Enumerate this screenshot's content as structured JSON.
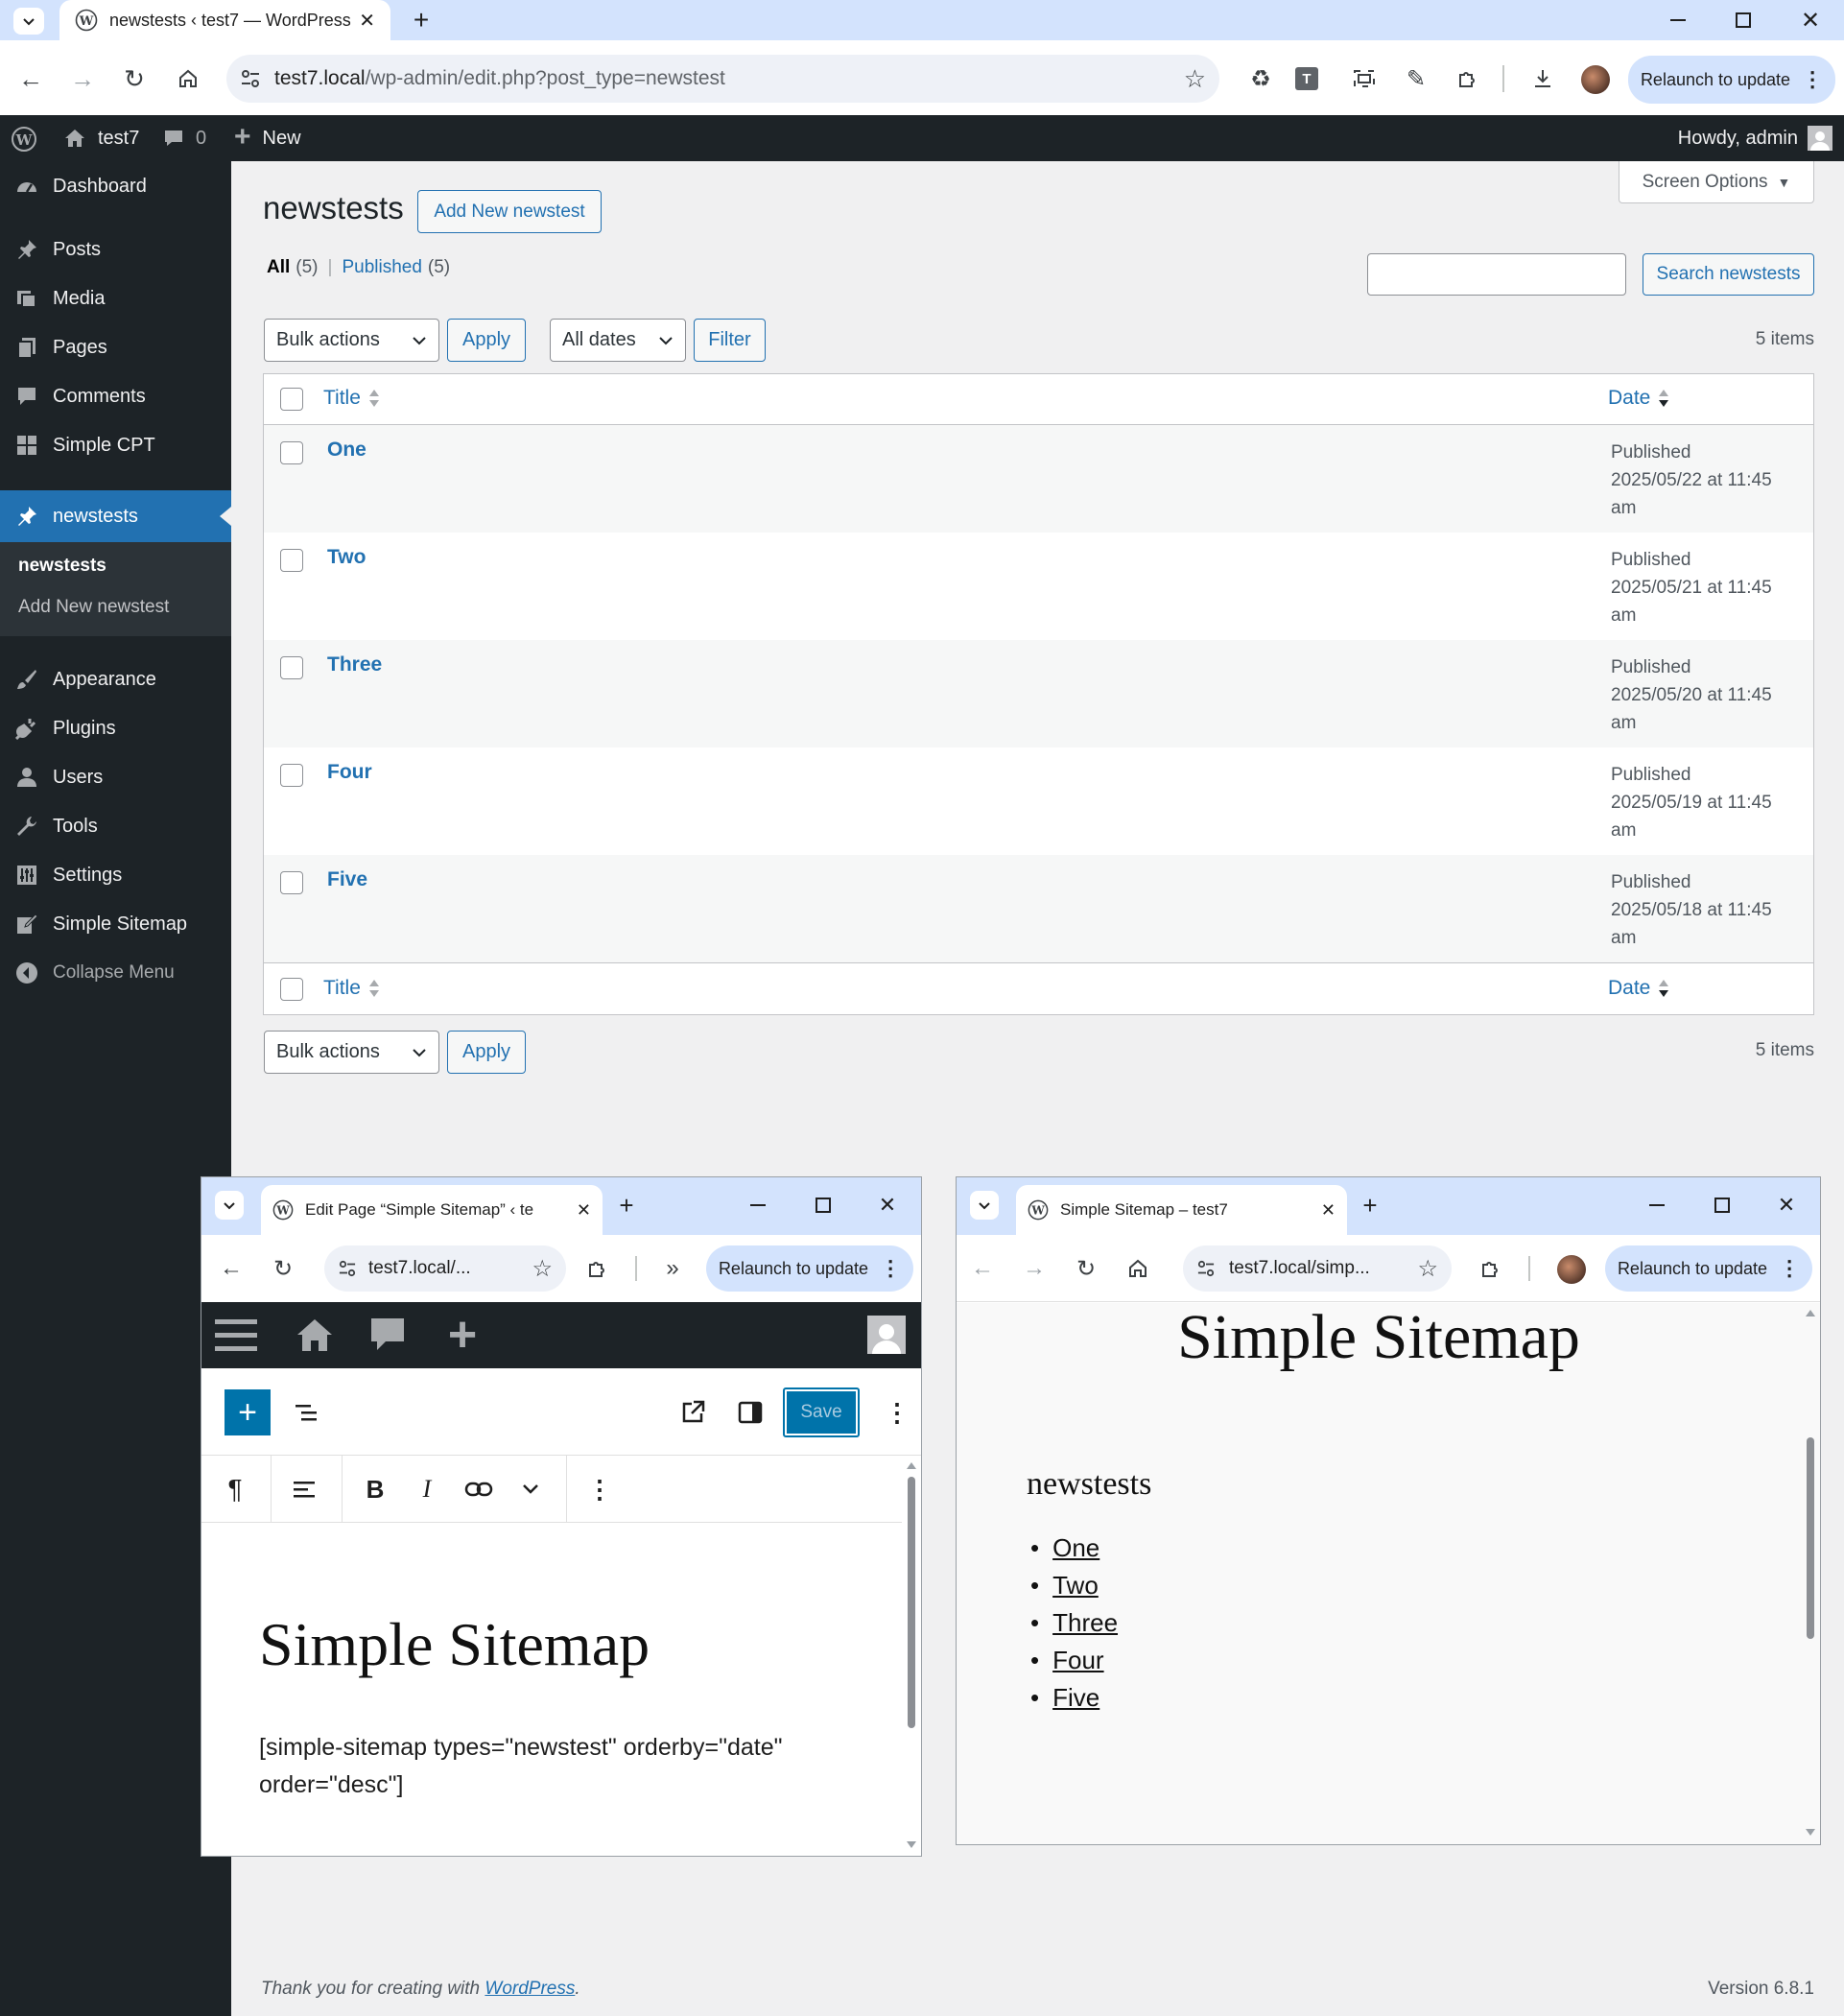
{
  "browser": {
    "tab_title": "newstests ‹ test7 — WordPress",
    "url_host": "test7.local",
    "url_path": "/wp-admin/edit.php?post_type=newstest",
    "relaunch": "Relaunch to update"
  },
  "adminbar": {
    "site": "test7",
    "comments": "0",
    "new": "New",
    "howdy": "Howdy, admin"
  },
  "sidebar": {
    "items": [
      {
        "label": "Dashboard",
        "icon": "dashboard-icon"
      },
      {
        "label": "Posts",
        "icon": "pin-icon"
      },
      {
        "label": "Media",
        "icon": "media-icon"
      },
      {
        "label": "Pages",
        "icon": "pages-icon"
      },
      {
        "label": "Comments",
        "icon": "comment-icon"
      },
      {
        "label": "Simple CPT",
        "icon": "grid-icon"
      },
      {
        "label": "newstests",
        "icon": "pin-icon"
      },
      {
        "label": "Appearance",
        "icon": "brush-icon"
      },
      {
        "label": "Plugins",
        "icon": "plugin-icon"
      },
      {
        "label": "Users",
        "icon": "user-icon"
      },
      {
        "label": "Tools",
        "icon": "wrench-icon"
      },
      {
        "label": "Settings",
        "icon": "settings-icon"
      },
      {
        "label": "Simple Sitemap",
        "icon": "edit-icon"
      }
    ],
    "sub_current": "newstests",
    "sub_add": "Add New newstest",
    "collapse": "Collapse Menu"
  },
  "main": {
    "title": "newstests",
    "add_new": "Add New newstest",
    "screen_options": "Screen Options",
    "filter_all": "All",
    "filter_all_count": "(5)",
    "filter_sep": "|",
    "filter_published": "Published",
    "filter_published_count": "(5)",
    "search_button": "Search newstests",
    "bulk_actions": "Bulk actions",
    "apply": "Apply",
    "all_dates": "All dates",
    "filter": "Filter",
    "items_count": "5 items",
    "col_title": "Title",
    "col_date": "Date",
    "rows": [
      {
        "title": "One",
        "status": "Published",
        "date": "2025/05/22 at 11:45",
        "ampm": "am"
      },
      {
        "title": "Two",
        "status": "Published",
        "date": "2025/05/21 at 11:45",
        "ampm": "am"
      },
      {
        "title": "Three",
        "status": "Published",
        "date": "2025/05/20 at 11:45",
        "ampm": "am"
      },
      {
        "title": "Four",
        "status": "Published",
        "date": "2025/05/19 at 11:45",
        "ampm": "am"
      },
      {
        "title": "Five",
        "status": "Published",
        "date": "2025/05/18 at 11:45",
        "ampm": "am"
      }
    ]
  },
  "footer": {
    "thanks": "Thank you for creating with",
    "wp_link": "WordPress",
    "period": ".",
    "version": "Version 6.8.1"
  },
  "editor_window": {
    "tab_title": "Edit Page “Simple Sitemap” ‹ te",
    "url": "test7.local/...",
    "relaunch": "Relaunch to update",
    "save": "Save",
    "heading": "Simple Sitemap",
    "shortcode": "[simple-sitemap types=\"newstest\" orderby=\"date\" order=\"desc\"]"
  },
  "sitemap_window": {
    "tab_title": "Simple Sitemap – test7",
    "url": "test7.local/simp...",
    "relaunch": "Relaunch to update",
    "heading": "Simple Sitemap",
    "subheading": "newstests",
    "links": [
      "One",
      "Two",
      "Three",
      "Four",
      "Five"
    ]
  }
}
